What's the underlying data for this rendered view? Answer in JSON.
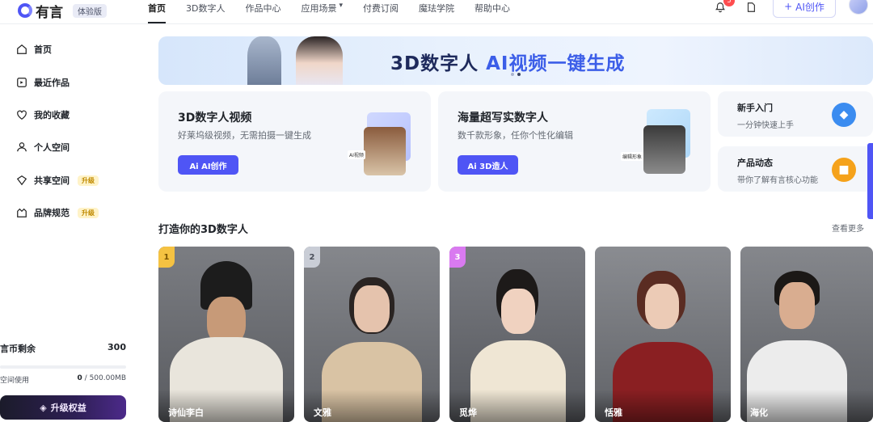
{
  "app": {
    "logo_text": "有言",
    "trial_badge": "体验版"
  },
  "nav": {
    "items": [
      {
        "label": "首页",
        "active": true
      },
      {
        "label": "3D数字人",
        "active": false
      },
      {
        "label": "作品中心",
        "active": false
      },
      {
        "label": "应用场景",
        "active": false,
        "has_dropdown": true
      },
      {
        "label": "付费订阅",
        "active": false
      },
      {
        "label": "魔珐学院",
        "active": false
      },
      {
        "label": "帮助中心",
        "active": false
      }
    ],
    "notification_count": "5",
    "ai_create_label": "AI创作"
  },
  "sidebar": {
    "items": [
      {
        "label": "首页",
        "icon": "home-icon"
      },
      {
        "label": "最近作品",
        "icon": "recent-icon"
      },
      {
        "label": "我的收藏",
        "icon": "heart-icon"
      },
      {
        "label": "个人空间",
        "icon": "user-icon"
      },
      {
        "label": "共享空间",
        "icon": "share-icon",
        "tag": "升级"
      },
      {
        "label": "品牌规范",
        "icon": "brand-icon",
        "tag": "升级"
      }
    ],
    "coins_label": "言币剩余",
    "coins_value": "300",
    "space_label": "空间使用",
    "space_used": "0",
    "space_total": " / 500.00MB",
    "upgrade_label": "升级权益"
  },
  "banner": {
    "title_a": "3D数字人 ",
    "title_b": "AI视频一键生成"
  },
  "feature_cards": [
    {
      "title": "3D数字人视频",
      "subtitle": "好莱坞级视频，无需拍摄一键生成",
      "button": "Ai AI创作",
      "art_label": "AI视频"
    },
    {
      "title": "海量超写实数字人",
      "subtitle": "数千款形象，任你个性化编辑",
      "button": "Ai 3D造人",
      "art_label": "编辑形象"
    }
  ],
  "mini_cards": [
    {
      "title": "新手入门",
      "subtitle": "一分钟快速上手",
      "icon": "graduation-cap-icon",
      "color": "#3b8cf0"
    },
    {
      "title": "产品动态",
      "subtitle": "带你了解有言核心功能",
      "icon": "gift-icon",
      "color": "#f5a21b"
    }
  ],
  "section": {
    "title": "打造你的3D数字人",
    "see_more": "查看更多"
  },
  "avatars": [
    {
      "name": "诗仙李白",
      "rank": "1",
      "rank_color": "#f5c242"
    },
    {
      "name": "文雅",
      "rank": "2",
      "rank_color": "#c9cdd6"
    },
    {
      "name": "觅烨",
      "rank": "3",
      "rank_color": "#d97af0"
    },
    {
      "name": "恬雅",
      "rank": "",
      "rank_color": ""
    },
    {
      "name": "海化",
      "rank": "",
      "rank_color": ""
    }
  ],
  "colors": {
    "accent": "#4f55f5",
    "dark": "#1f2329"
  }
}
